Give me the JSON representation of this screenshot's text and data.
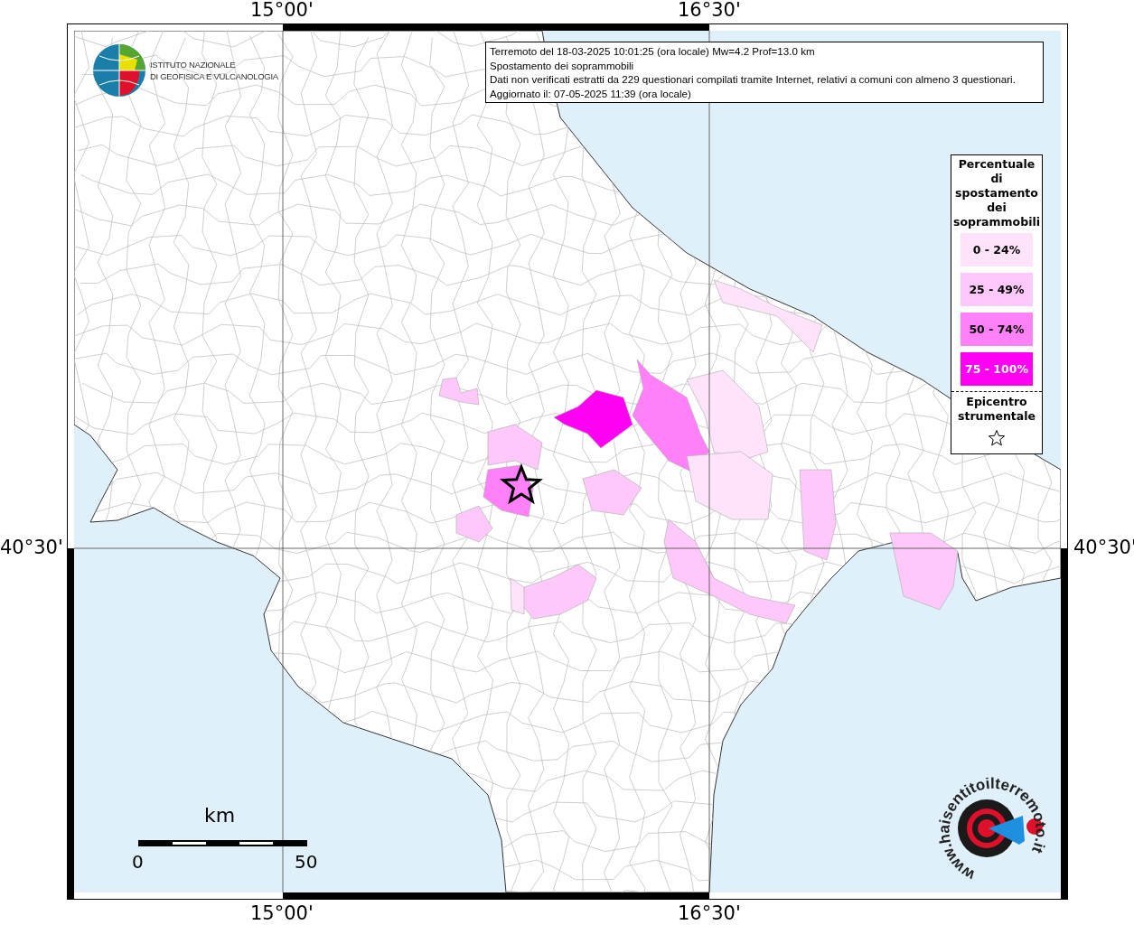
{
  "header": {
    "lines": [
      "Terremoto del 18-03-2025 10:01:25 (ora locale) Mw=4.2 Prof=13.0 km",
      "Spostamento dei soprammobili",
      "Dati non verificati estratti da 229 questionari compilati tramite Internet, relativi a comuni con almeno 3 questionari.",
      "Aggiornato il: 07-05-2025 11:39 (ora locale)"
    ]
  },
  "logo": {
    "lines": [
      "ISTITUTO NAZIONALE",
      "DI GEOFISICA E VULCANOLOGIA"
    ]
  },
  "axes": {
    "top": [
      "15°00'",
      "16°30'"
    ],
    "bottom": [
      "15°00'",
      "16°30'"
    ],
    "left": [
      "40°30'"
    ],
    "right": [
      "40°30'"
    ]
  },
  "legend": {
    "title": "Percentuale di spostamento dei soprammobili",
    "classes": [
      {
        "label": "0 - 24%",
        "color": "#ffe3fb"
      },
      {
        "label": "25 - 49%",
        "color": "#ffc8fb"
      },
      {
        "label": "50 - 74%",
        "color": "#ff80f7"
      },
      {
        "label": "75 - 100%",
        "color": "#ff00f2"
      }
    ],
    "epicenter_label": "Epicentro strumentale"
  },
  "scale_bar": {
    "unit": "km",
    "ticks": [
      "0",
      "50"
    ]
  },
  "badge": {
    "text": "www.haisentitoilterremoto.it"
  }
}
